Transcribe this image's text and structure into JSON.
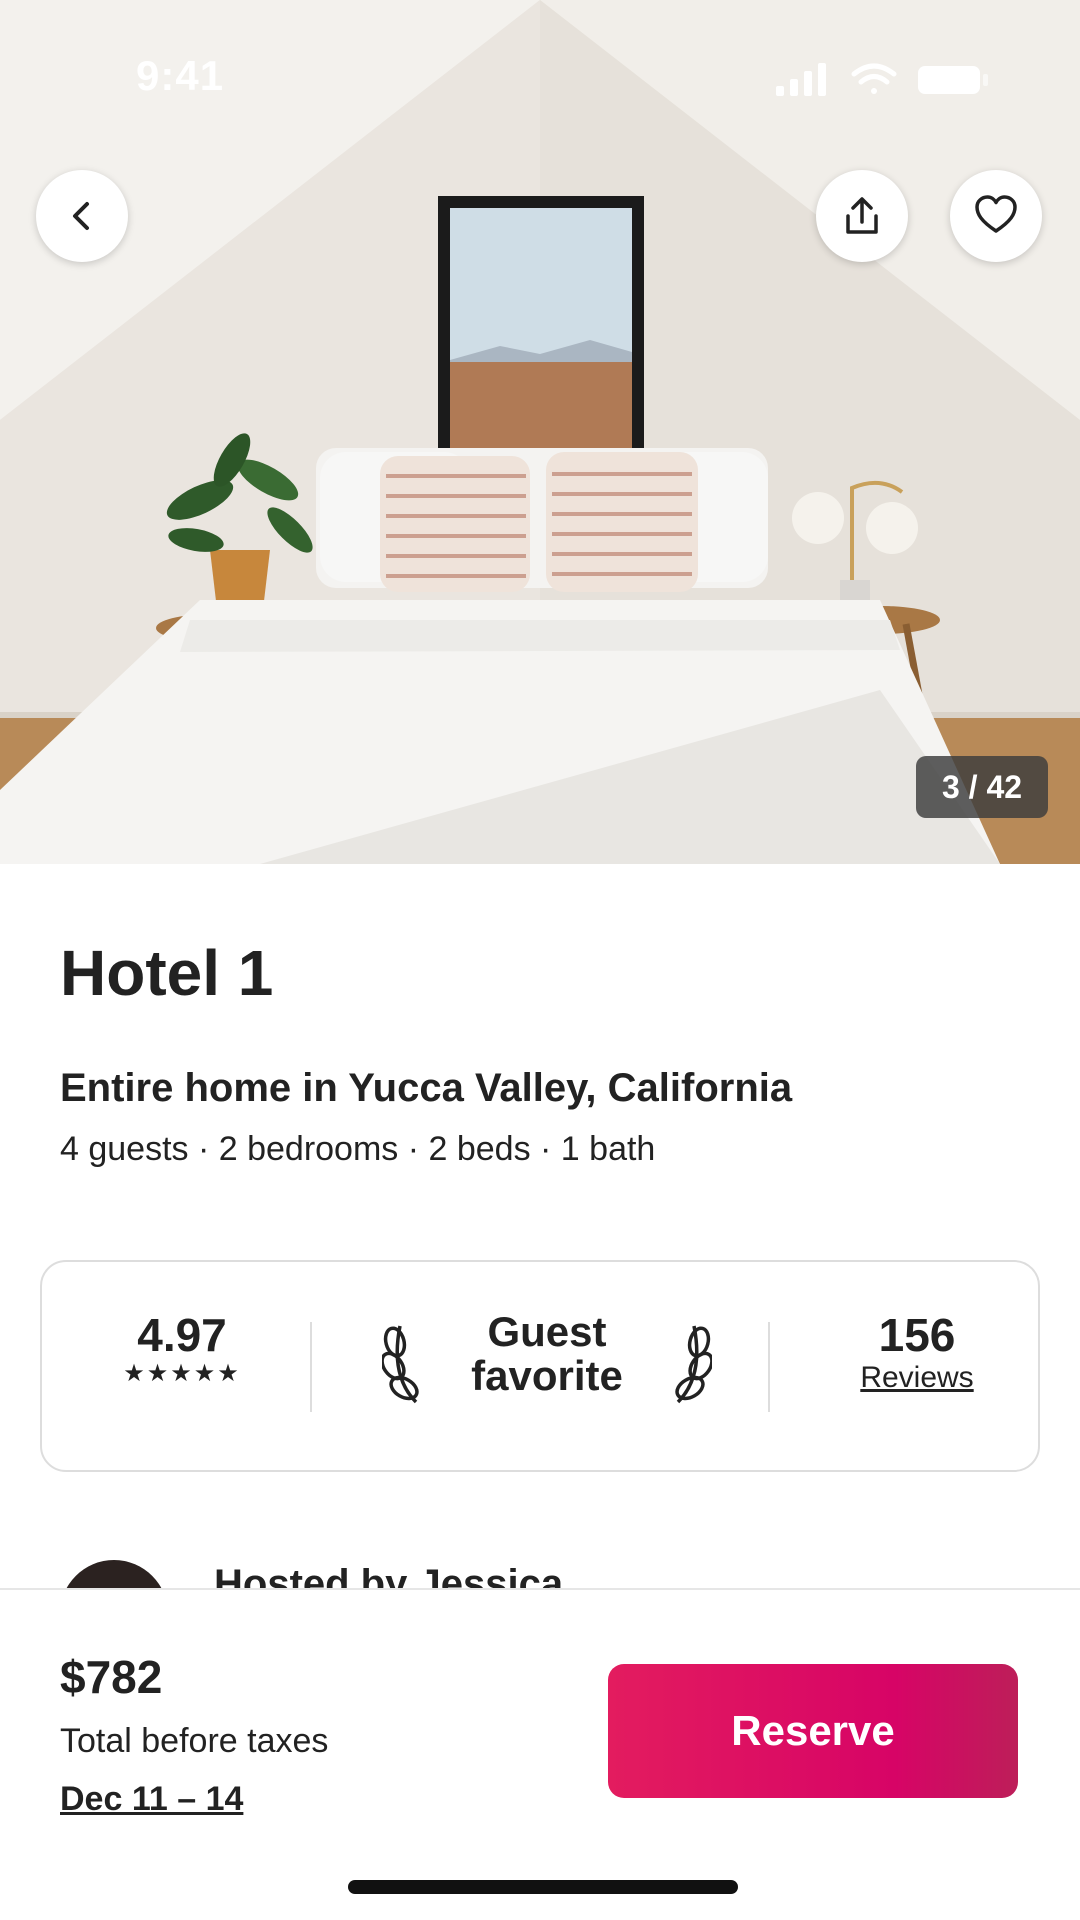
{
  "status_bar": {
    "time": "9:41"
  },
  "hero": {
    "photo_description_icon": "bedroom-photo",
    "counter": "3 / 42"
  },
  "nav": {
    "back_icon": "chevron-left-icon",
    "share_icon": "share-icon",
    "favorite_icon": "heart-icon"
  },
  "listing": {
    "title": "Hotel 1",
    "subtitle": "Entire home in Yucca Valley, California",
    "details": "4 guests · 2 bedrooms · 2 beds · 1 bath"
  },
  "rating_card": {
    "rating": "4.97",
    "stars": "★★★★★",
    "badge_line1": "Guest",
    "badge_line2": "favorite",
    "reviews_count": "156",
    "reviews_label": "Reviews"
  },
  "host": {
    "text": "Hosted by Jessica"
  },
  "footer": {
    "price": "$782",
    "price_note": "Total before taxes",
    "dates": "Dec 11 – 14",
    "reserve_label": "Reserve"
  },
  "colors": {
    "brand": "#e31c5f",
    "text": "#222222",
    "border": "#dddddd"
  }
}
